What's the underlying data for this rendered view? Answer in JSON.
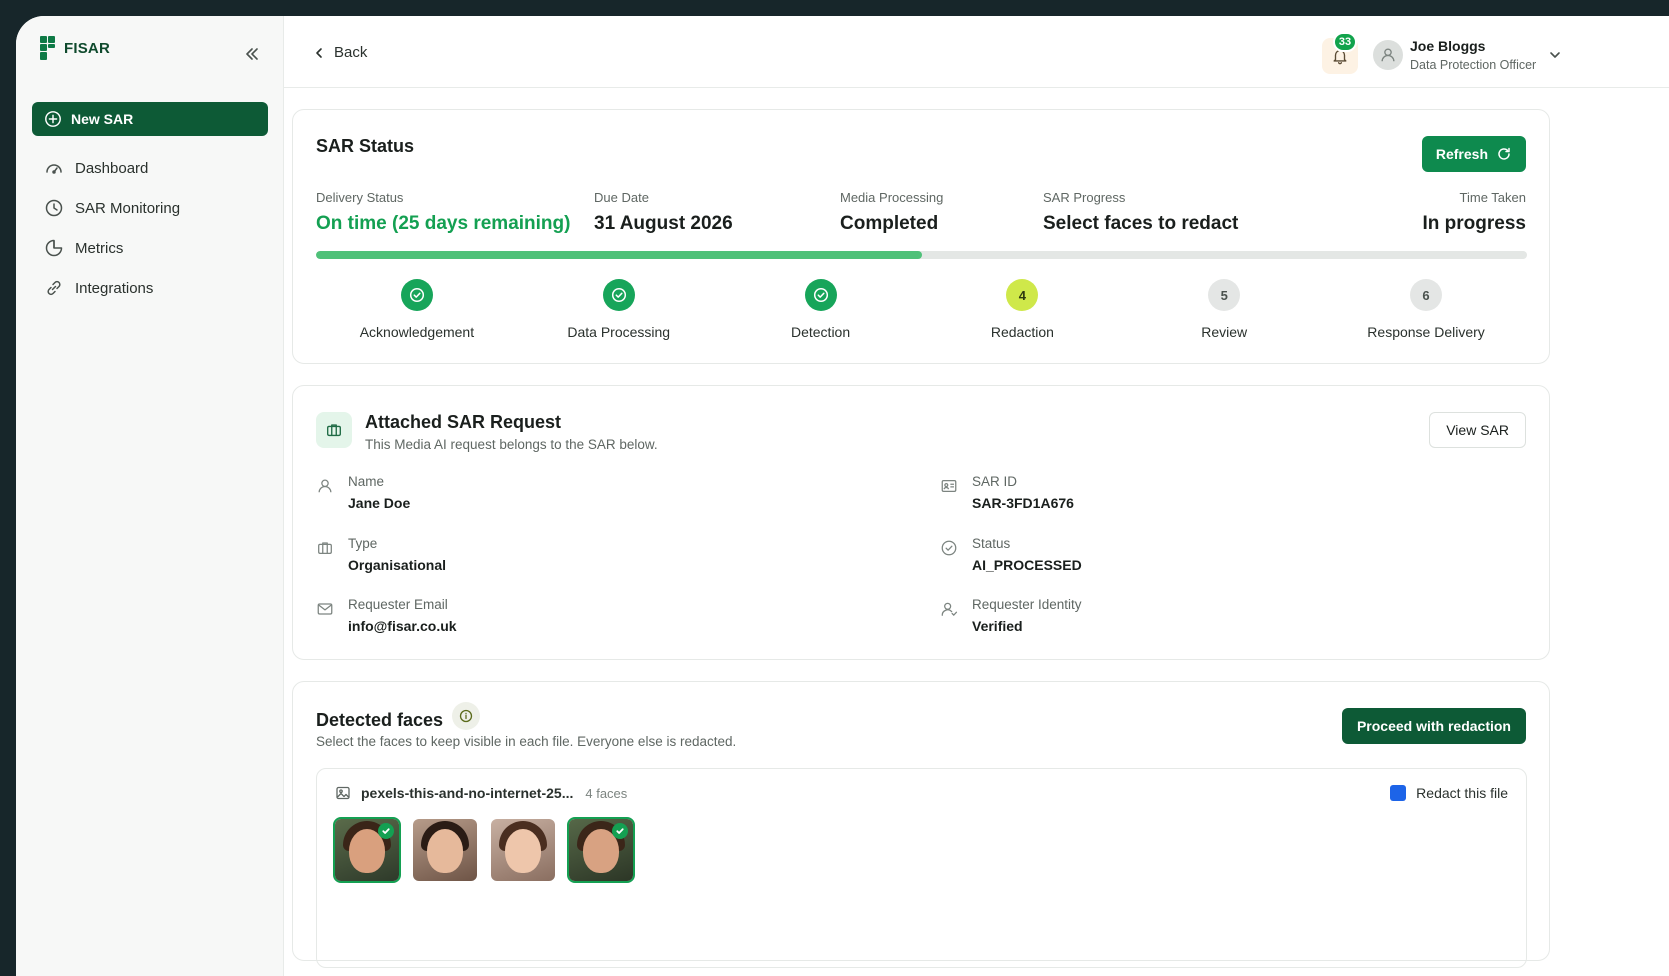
{
  "app": {
    "logo_text": "FISAR"
  },
  "sidebar": {
    "new_sar_label": "New SAR",
    "items": [
      {
        "label": "Dashboard",
        "icon": "gauge-icon"
      },
      {
        "label": "SAR Monitoring",
        "icon": "clock-icon"
      },
      {
        "label": "Metrics",
        "icon": "pie-chart-icon"
      },
      {
        "label": "Integrations",
        "icon": "link-icon"
      }
    ]
  },
  "topbar": {
    "back_label": "Back",
    "notification_count": "33",
    "user_name": "Joe Bloggs",
    "user_role": "Data Protection Officer"
  },
  "status_card": {
    "title": "SAR Status",
    "refresh_label": "Refresh",
    "stats": [
      {
        "label": "Delivery Status",
        "value": "On time (25 days remaining)"
      },
      {
        "label": "Due Date",
        "value": "31 August 2026"
      },
      {
        "label": "Media Processing",
        "value": "Completed"
      },
      {
        "label": "SAR Progress",
        "value": "Select faces to redact"
      },
      {
        "label": "Time Taken",
        "value": "In progress"
      }
    ],
    "progress_fraction": 0.5,
    "steps": [
      {
        "label": "Acknowledgement",
        "state": "done"
      },
      {
        "label": "Data Processing",
        "state": "done"
      },
      {
        "label": "Detection",
        "state": "done"
      },
      {
        "label": "Redaction",
        "state": "current",
        "number": "4"
      },
      {
        "label": "Review",
        "state": "todo",
        "number": "5"
      },
      {
        "label": "Response Delivery",
        "state": "todo",
        "number": "6"
      }
    ],
    "accent_color": "#14a052"
  },
  "attached_card": {
    "title": "Attached SAR Request",
    "subtitle": "This Media AI request belongs to the SAR below.",
    "view_label": "View SAR",
    "fields": {
      "name": {
        "label": "Name",
        "value": "Jane Doe"
      },
      "sar_id": {
        "label": "SAR ID",
        "value": "SAR-3FD1A676"
      },
      "type": {
        "label": "Type",
        "value": "Organisational"
      },
      "status": {
        "label": "Status",
        "value": "AI_PROCESSED"
      },
      "email": {
        "label": "Requester Email",
        "value": "info@fisar.co.uk"
      },
      "identity": {
        "label": "Requester Identity",
        "value": "Verified"
      }
    }
  },
  "faces_card": {
    "title": "Detected faces",
    "subtitle": "Select the faces to keep visible in each file. Everyone else is redacted.",
    "proceed_label": "Proceed with redaction",
    "file": {
      "name": "pexels-this-and-no-internet-25...",
      "count": "4 faces",
      "redact_label": "Redact this file",
      "redact_checked": true,
      "faces_selected": [
        true,
        false,
        false,
        true
      ]
    }
  }
}
